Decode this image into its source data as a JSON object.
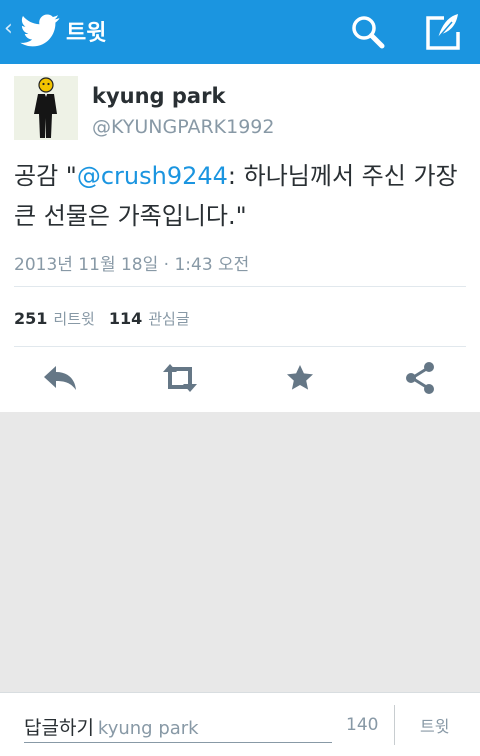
{
  "appbar": {
    "back_glyph": "‹",
    "title": "트윗",
    "icons": [
      "twitter-bird-icon",
      "search-icon",
      "compose-icon"
    ],
    "color": "#1b95e0"
  },
  "tweet": {
    "name": "kyung park",
    "handle": "@KYUNGPARK1992",
    "text_prefix": "공감 \"",
    "mention": "@crush9244",
    "text_suffix": ": 하나님께서 주신 가장 큰 선물은 가족입니다.\"",
    "timestamp": "2013년 11월 18일 · 1:43 오전",
    "retweet_count": "251",
    "retweet_label": "리트윗",
    "favorite_count": "114",
    "favorite_label": "관심글",
    "actions": [
      "reply-icon",
      "retweet-icon",
      "favorite-icon",
      "share-icon"
    ]
  },
  "reply": {
    "prefix": "답글하기",
    "placeholder": "kyung park",
    "counter": "140",
    "tweet_button": "트윗"
  }
}
